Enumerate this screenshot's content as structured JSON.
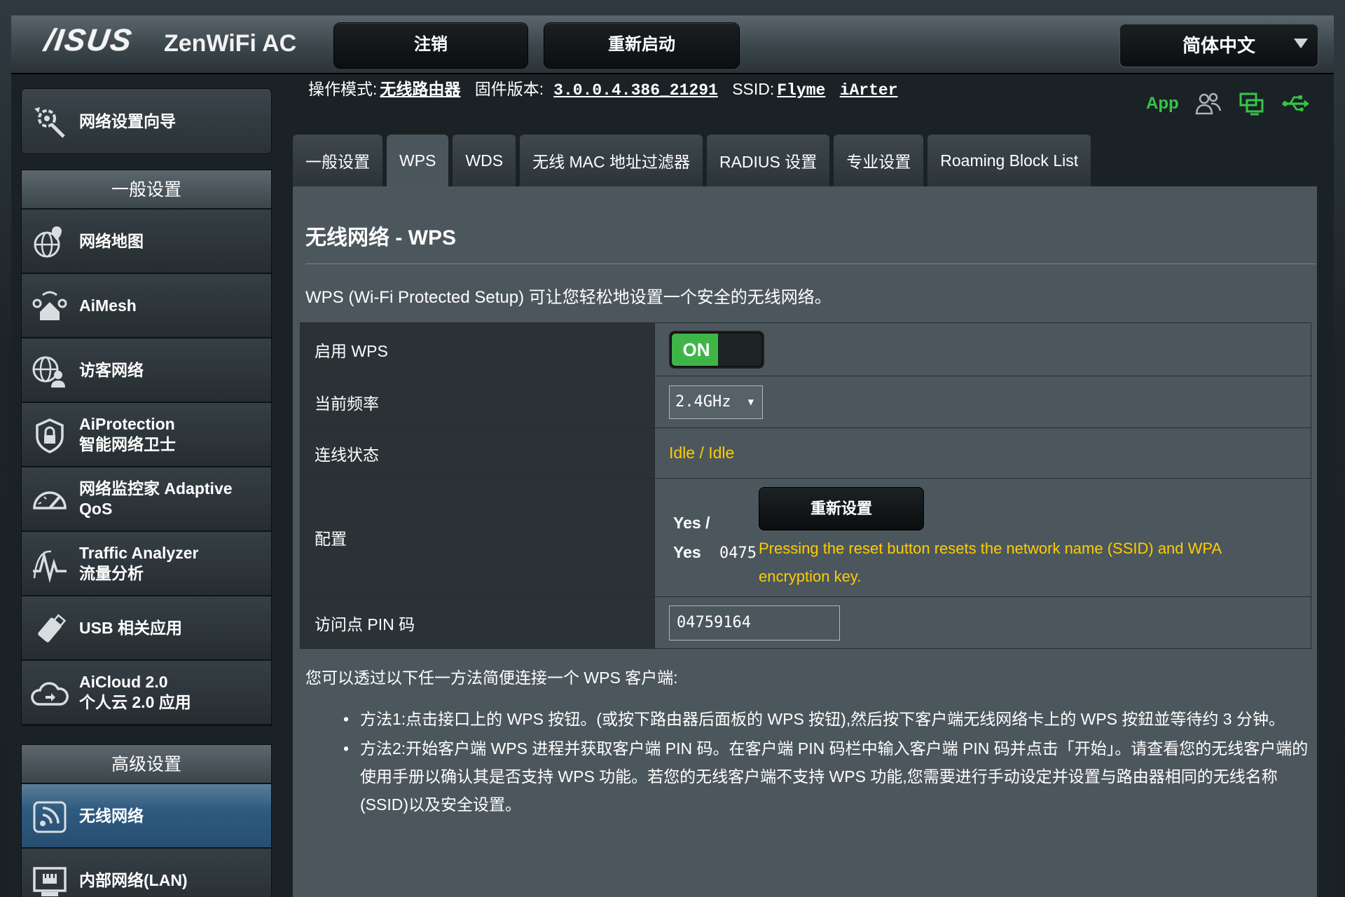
{
  "header": {
    "brand": "/ISUS",
    "model": "ZenWiFi AC",
    "logout_label": "注销",
    "reboot_label": "重新启动",
    "language": "简体中文"
  },
  "status": {
    "mode_label": "操作模式:",
    "mode_value": "无线路由器",
    "firmware_label": "固件版本:",
    "firmware_value": "3.0.0.4.386_21291",
    "ssid_label": "SSID:",
    "ssid_1": "Flyme",
    "ssid_2": "iArter",
    "app_label": "App"
  },
  "sidebar": {
    "wizard": "网络设置向导",
    "general_header": "一般设置",
    "general_items": [
      {
        "line1": "网络地图",
        "line2": ""
      },
      {
        "line1": "AiMesh",
        "line2": ""
      },
      {
        "line1": "访客网络",
        "line2": ""
      },
      {
        "line1": "AiProtection",
        "line2": "智能网络卫士"
      },
      {
        "line1": "网络监控家 Adaptive",
        "line2": "QoS"
      },
      {
        "line1": "Traffic Analyzer",
        "line2": "流量分析"
      },
      {
        "line1": "USB 相关应用",
        "line2": ""
      },
      {
        "line1": "AiCloud 2.0",
        "line2": "个人云 2.0 应用"
      }
    ],
    "advanced_header": "高级设置",
    "advanced_items": [
      {
        "line1": "无线网络",
        "line2": ""
      },
      {
        "line1": "内部网络(LAN)",
        "line2": ""
      }
    ]
  },
  "tabs": [
    "一般设置",
    "WPS",
    "WDS",
    "无线 MAC 地址过滤器",
    "RADIUS 设置",
    "专业设置",
    "Roaming Block List"
  ],
  "page": {
    "title": "无线网络 - WPS",
    "description": "WPS (Wi-Fi Protected Setup) 可让您轻松地设置一个安全的无线网络。",
    "rows": {
      "enable_label": "启用 WPS",
      "enable_value": "ON",
      "band_label": "当前频率",
      "band_value": "2.4GHz",
      "state_label": "连线状态",
      "state_value": "Idle / Idle",
      "config_label": "配置",
      "config_yes1": "Yes /",
      "config_yes2": "Yes",
      "config_pin_part": "0475",
      "reset_label": "重新设置",
      "reset_hint": "Pressing the reset button resets the network name (SSID) and WPA encryption key.",
      "pin_label": "访问点 PIN 码",
      "pin_value": "04759164"
    },
    "methods_intro": "您可以透过以下任一方法简便连接一个 WPS 客户端:",
    "methods": [
      "方法1:点击接口上的 WPS 按钮。(或按下路由器后面板的 WPS 按钮),然后按下客户端无线网络卡上的 WPS 按鈕並等待约 3 分钟。",
      "方法2:开始客户端 WPS 进程并获取客户端 PIN 码。在客户端 PIN 码栏中输入客户端 PIN 码并点击「开始」。请查看您的无线客户端的使用手册以确认其是否支持 WPS 功能。若您的无线客户端不支持 WPS 功能,您需要进行手动设定并设置与路由器相同的无线名称(SSID)以及安全设置。"
    ]
  },
  "colors": {
    "accent_green": "#3fb548",
    "warning_yellow": "#ffcc00",
    "active_blue": "#2f5b80"
  },
  "icons": [
    "wizard-icon",
    "network-map-icon",
    "aimesh-icon",
    "guest-network-icon",
    "aiprotection-icon",
    "qos-icon",
    "traffic-analyzer-icon",
    "usb-icon",
    "aicloud-icon",
    "wireless-icon",
    "lan-icon",
    "users-icon",
    "network-status-icon",
    "usb-status-icon"
  ]
}
